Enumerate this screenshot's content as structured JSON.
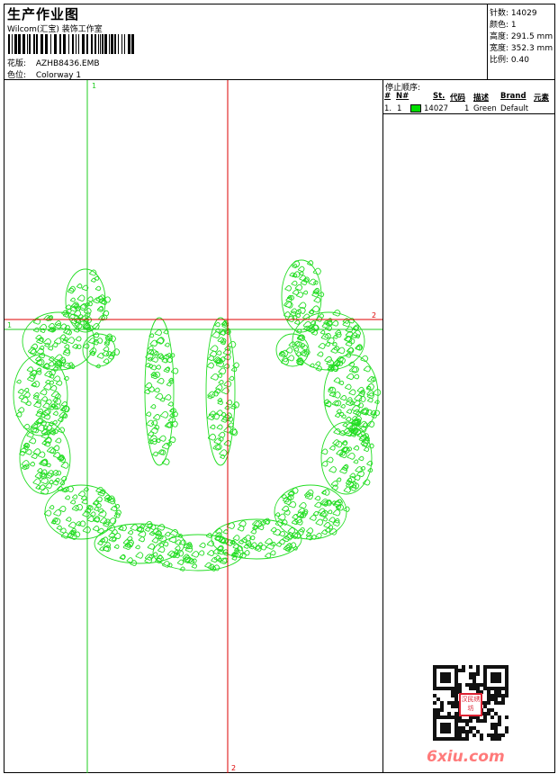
{
  "header": {
    "title": "生产作业图",
    "company": "Wilcom(汇宝) 装饰工作室",
    "design_label": "花版:",
    "design_value": "AZHB8436.EMB",
    "colorway_label": "色位:",
    "colorway_value": "Colorway 1"
  },
  "stats": [
    {
      "label": "针数:",
      "value": "14029"
    },
    {
      "label": "颜色:",
      "value": "1"
    },
    {
      "label": "高度:",
      "value": "291.5 mm"
    },
    {
      "label": "宽度:",
      "value": "352.3 mm"
    },
    {
      "label": "比例:",
      "value": "0.40"
    }
  ],
  "guides": {
    "green_vertical": "1",
    "green_horizontal": "1",
    "red_horizontal": "2",
    "red_vertical": "2"
  },
  "sequence": {
    "title": "停止顺序:",
    "headers": {
      "hash": "#",
      "no": "N#",
      "st": "St.",
      "code": "代码",
      "desc": "描述",
      "brand": "Brand",
      "element": "元素"
    },
    "rows": [
      {
        "index": "1.",
        "no": "1",
        "color": "#00dd00",
        "stitches": "14027",
        "code": "1",
        "desc": "Green",
        "brand": "Default"
      }
    ]
  },
  "watermark": {
    "seal_text": "汉民绣坊",
    "site": "6xiu.com"
  },
  "colors": {
    "stitch": "#22dd22",
    "guide_green": "#22cc22",
    "guide_red": "#dd0000"
  }
}
